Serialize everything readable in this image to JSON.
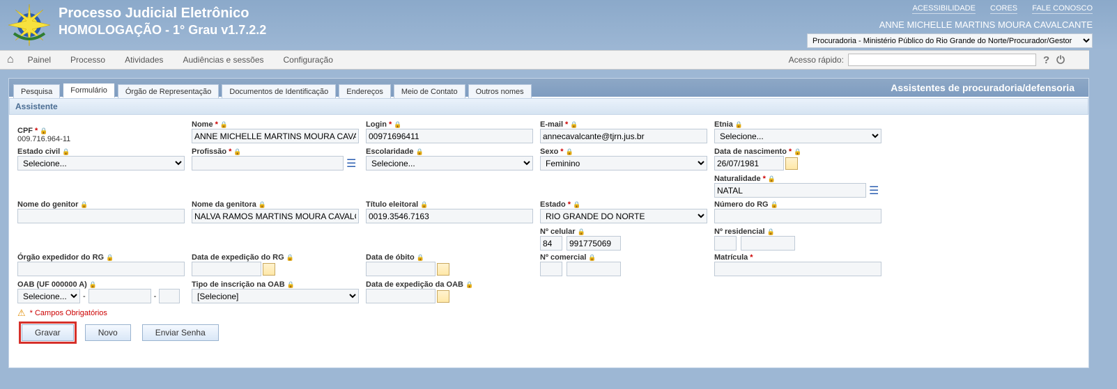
{
  "header": {
    "title1": "Processo Judicial Eletrônico",
    "title2": "HOMOLOGAÇÃO - 1° Grau v1.7.2.2",
    "links": {
      "acessibilidade": "ACESSIBILIDADE",
      "cores": "CORES",
      "fale": "FALE CONOSCO"
    },
    "username": "ANNE MICHELLE MARTINS MOURA CAVALCANTE",
    "procuradoria_selected": "Procuradoria - Ministério Público do Rio Grande do Norte/Procurador/Gestor"
  },
  "menu": {
    "painel": "Painel",
    "processo": "Processo",
    "atividades": "Atividades",
    "audiencias": "Audiências e sessões",
    "config": "Configuração",
    "acesso_label": "Acesso rápido:"
  },
  "page_title": "Assistentes de procuradoria/defensoria",
  "tabs": {
    "pesquisa": "Pesquisa",
    "formulario": "Formulário",
    "orgao": "Órgão de Representação",
    "documentos": "Documentos de Identificação",
    "enderecos": "Endereços",
    "contato": "Meio de Contato",
    "outros": "Outros nomes"
  },
  "section": "Assistente",
  "labels": {
    "cpf": "CPF",
    "nome": "Nome",
    "login": "Login",
    "email": "E-mail",
    "etnia": "Etnia",
    "estado_civil": "Estado civil",
    "profissao": "Profissão",
    "escolaridade": "Escolaridade",
    "sexo": "Sexo",
    "data_nasc": "Data de nascimento",
    "nome_genitor": "Nome do genitor",
    "nome_genitora": "Nome da genitora",
    "titulo_eleitoral": "Título eleitoral",
    "estado": "Estado",
    "naturalidade": "Naturalidade",
    "numero_rg": "Número do RG",
    "orgao_rg": "Órgão expedidor do RG",
    "data_exp_rg": "Data de expedição do RG",
    "data_obito": "Data de óbito",
    "n_celular": "Nº celular",
    "n_residencial": "Nº residencial",
    "n_comercial": "Nº comercial",
    "matricula": "Matrícula",
    "oab": "OAB (UF 000000 A)",
    "tipo_oab": "Tipo de inscrição na OAB",
    "data_exp_oab": "Data de expedição da OAB",
    "campos_obrig": "* Campos Obrigatórios"
  },
  "values": {
    "cpf": "009.716.964-11",
    "nome": "ANNE MICHELLE MARTINS MOURA CAVALCANTE",
    "login": "00971696411",
    "email": "annecavalcante@tjrn.jus.br",
    "etnia": "Selecione...",
    "estado_civil": "Selecione...",
    "profissao": "",
    "escolaridade": "Selecione...",
    "sexo": "Feminino",
    "data_nasc": "26/07/1981",
    "nome_genitor": "",
    "nome_genitora": "NALVA RAMOS MARTINS MOURA CAVALCANTE",
    "titulo_eleitoral": "0019.3546.7163",
    "estado": "RIO GRANDE DO NORTE",
    "naturalidade": "NATAL",
    "numero_rg": "",
    "orgao_rg": "",
    "data_exp_rg": "",
    "data_obito": "",
    "cel_ddd": "84",
    "cel_num": "991775069",
    "res_ddd": "",
    "res_num": "",
    "com_ddd": "",
    "com_num": "",
    "matricula": "",
    "oab_uf": "Selecione...",
    "oab_num": "",
    "oab_letra": "",
    "tipo_oab": "[Selecione]",
    "data_exp_oab": ""
  },
  "buttons": {
    "gravar": "Gravar",
    "novo": "Novo",
    "enviar_senha": "Enviar Senha"
  }
}
